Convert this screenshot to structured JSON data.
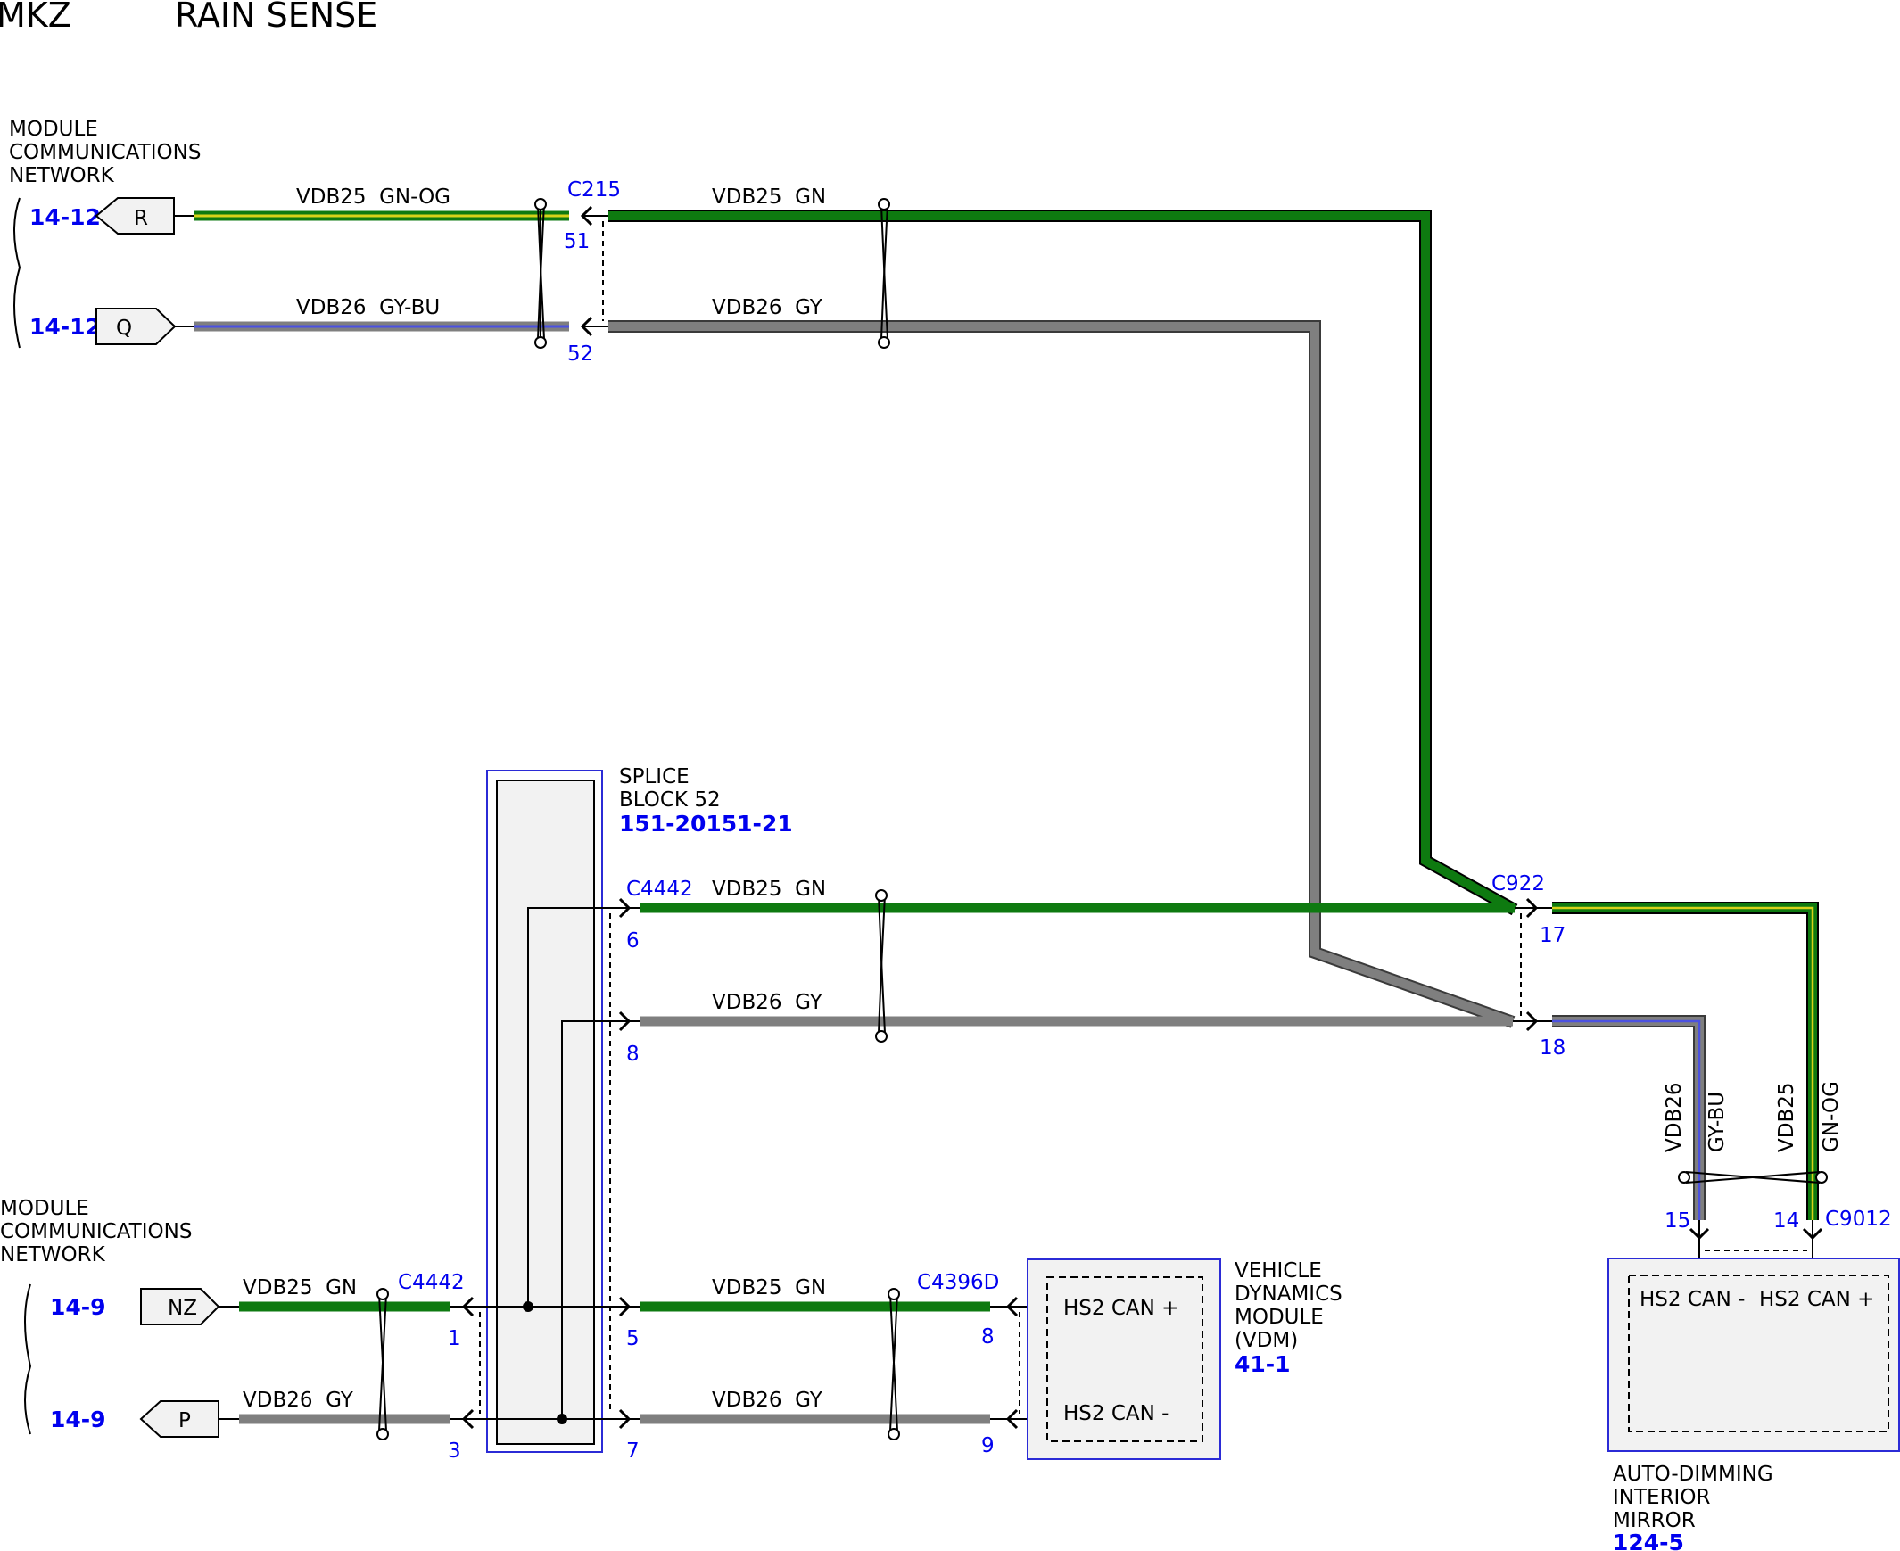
{
  "header": {
    "vehicle": "MKZ",
    "title": "RAIN SENSE"
  },
  "colors": {
    "wire_green": "#0e7a10",
    "wire_gray": "#7f7f7f",
    "stripe_yellow": "#d7d21a",
    "stripe_blue": "#4b51e0",
    "ref_blue": "#0000ee",
    "box_fill": "#f2f2f2",
    "box_border": "#2b2bd6"
  },
  "networks": {
    "top": {
      "label": [
        "MODULE",
        "COMMUNICATIONS",
        "NETWORK"
      ],
      "refs": [
        "14-12",
        "14-12"
      ],
      "arrows": [
        "R",
        "Q"
      ]
    },
    "bottom": {
      "label": [
        "MODULE",
        "COMMUNICATIONS",
        "NETWORK"
      ],
      "refs": [
        "14-9",
        "14-9"
      ],
      "arrows": [
        "NZ",
        "P"
      ]
    }
  },
  "connectors": {
    "c215": {
      "name": "C215",
      "pins": [
        "51",
        "52"
      ]
    },
    "c4442_right": {
      "name": "C4442",
      "pins": [
        "6",
        "8",
        "5",
        "7"
      ]
    },
    "c4442_left": {
      "name": "C4442",
      "pins": [
        "1",
        "3"
      ]
    },
    "c922": {
      "name": "C922",
      "pins": [
        "17",
        "18"
      ]
    },
    "c4396d": {
      "name": "C4396D",
      "pins": [
        "8",
        "9"
      ]
    },
    "c9012": {
      "name": "C9012",
      "pins": [
        "15",
        "14"
      ]
    }
  },
  "wires": {
    "top_left_1": "VDB25  GN-OG",
    "top_left_2": "VDB26  GY-BU",
    "top_right_1": "VDB25  GN",
    "top_right_2": "VDB26  GY",
    "mid_1": "VDB25  GN",
    "mid_2": "VDB26  GY",
    "bottom_left_1": "VDB25  GN",
    "bottom_left_2": "VDB26  GY",
    "bottom_mid_1": "VDB25  GN",
    "bottom_mid_2": "VDB26  GY",
    "mirror_vdb26_circuit": "VDB26",
    "mirror_vdb26_color": "GY-BU",
    "mirror_vdb25_circuit": "VDB25",
    "mirror_vdb25_color": "GN-OG"
  },
  "components": {
    "splice": {
      "label": [
        "SPLICE",
        "BLOCK 52"
      ],
      "ref": "151-20151-21"
    },
    "vdm": {
      "label": [
        "VEHICLE",
        "DYNAMICS",
        "MODULE",
        "(VDM)"
      ],
      "ref": "41-1",
      "pins": [
        "HS2 CAN +",
        "HS2 CAN -"
      ]
    },
    "mirror": {
      "label": [
        "AUTO-DIMMING",
        "INTERIOR",
        "MIRROR"
      ],
      "ref": "124-5",
      "pins": [
        "HS2 CAN -",
        "HS2 CAN +"
      ]
    }
  }
}
